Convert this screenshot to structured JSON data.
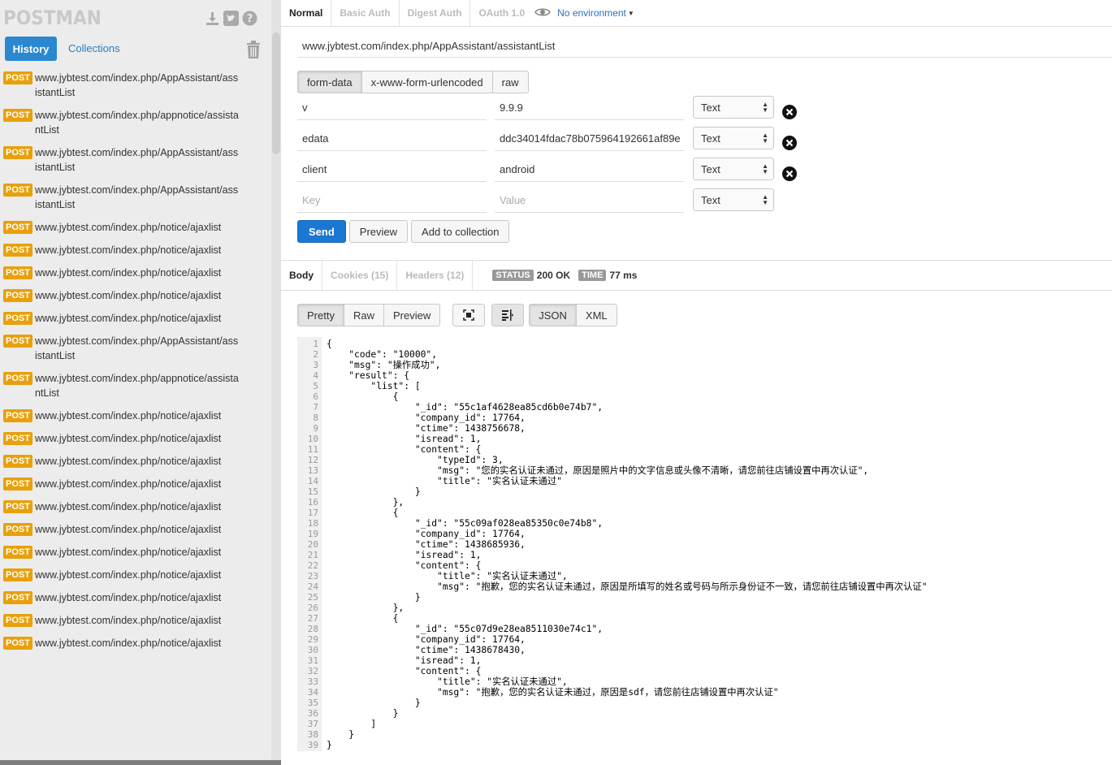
{
  "sidebar": {
    "logo": "POSTMAN",
    "tabs": {
      "history": "History",
      "collections": "Collections"
    },
    "history": [
      {
        "method": "POST",
        "url": "www.jybtest.com/index.php/AppAssistant/assistantList"
      },
      {
        "method": "POST",
        "url": "www.jybtest.com/index.php/appnotice/assistantList"
      },
      {
        "method": "POST",
        "url": "www.jybtest.com/index.php/AppAssistant/assistantList"
      },
      {
        "method": "POST",
        "url": "www.jybtest.com/index.php/AppAssistant/assistantList"
      },
      {
        "method": "POST",
        "url": "www.jybtest.com/index.php/notice/ajaxlist"
      },
      {
        "method": "POST",
        "url": "www.jybtest.com/index.php/notice/ajaxlist"
      },
      {
        "method": "POST",
        "url": "www.jybtest.com/index.php/notice/ajaxlist"
      },
      {
        "method": "POST",
        "url": "www.jybtest.com/index.php/notice/ajaxlist"
      },
      {
        "method": "POST",
        "url": "www.jybtest.com/index.php/notice/ajaxlist"
      },
      {
        "method": "POST",
        "url": "www.jybtest.com/index.php/AppAssistant/assistantList"
      },
      {
        "method": "POST",
        "url": "www.jybtest.com/index.php/appnotice/assistantList"
      },
      {
        "method": "POST",
        "url": "www.jybtest.com/index.php/notice/ajaxlist"
      },
      {
        "method": "POST",
        "url": "www.jybtest.com/index.php/notice/ajaxlist"
      },
      {
        "method": "POST",
        "url": "www.jybtest.com/index.php/notice/ajaxlist"
      },
      {
        "method": "POST",
        "url": "www.jybtest.com/index.php/notice/ajaxlist"
      },
      {
        "method": "POST",
        "url": "www.jybtest.com/index.php/notice/ajaxlist"
      },
      {
        "method": "POST",
        "url": "www.jybtest.com/index.php/notice/ajaxlist"
      },
      {
        "method": "POST",
        "url": "www.jybtest.com/index.php/notice/ajaxlist"
      },
      {
        "method": "POST",
        "url": "www.jybtest.com/index.php/notice/ajaxlist"
      },
      {
        "method": "POST",
        "url": "www.jybtest.com/index.php/notice/ajaxlist"
      },
      {
        "method": "POST",
        "url": "www.jybtest.com/index.php/notice/ajaxlist"
      },
      {
        "method": "POST",
        "url": "www.jybtest.com/index.php/notice/ajaxlist"
      }
    ]
  },
  "auth_tabs": [
    "Normal",
    "Basic Auth",
    "Digest Auth",
    "OAuth 1.0"
  ],
  "environment": "No environment",
  "request_url": "www.jybtest.com/index.php/AppAssistant/assistantList",
  "body_modes": [
    "form-data",
    "x-www-form-urlencoded",
    "raw"
  ],
  "params": [
    {
      "key": "v",
      "value": "9.9.9",
      "type": "Text"
    },
    {
      "key": "edata",
      "value": "ddc34014fdac78b075964192661af89e",
      "type": "Text"
    },
    {
      "key": "client",
      "value": "android",
      "type": "Text"
    }
  ],
  "new_param": {
    "key_placeholder": "Key",
    "value_placeholder": "Value",
    "type": "Text"
  },
  "actions": {
    "send": "Send",
    "preview": "Preview",
    "add_to_collection": "Add to collection"
  },
  "response_tabs": [
    "Body",
    "Cookies (15)",
    "Headers (12)"
  ],
  "status": {
    "status_label": "STATUS",
    "status_value": "200 OK",
    "time_label": "TIME",
    "time_value": "77 ms"
  },
  "view_modes": [
    "Pretty",
    "Raw",
    "Preview"
  ],
  "format_modes": [
    "JSON",
    "XML"
  ],
  "response_lines": [
    "{",
    "    \"code\": \"10000\",",
    "    \"msg\": \"操作成功\",",
    "    \"result\": {",
    "        \"list\": [",
    "            {",
    "                \"_id\": \"55c1af4628ea85cd6b0e74b7\",",
    "                \"company_id\": 17764,",
    "                \"ctime\": 1438756678,",
    "                \"isread\": 1,",
    "                \"content\": {",
    "                    \"typeId\": 3,",
    "                    \"msg\": \"您的实名认证未通过，原因是照片中的文字信息或头像不清晰，请您前往店铺设置中再次认证\",",
    "                    \"title\": \"实名认证未通过\"",
    "                }",
    "            },",
    "            {",
    "                \"_id\": \"55c09af028ea85350c0e74b8\",",
    "                \"company_id\": 17764,",
    "                \"ctime\": 1438685936,",
    "                \"isread\": 1,",
    "                \"content\": {",
    "                    \"title\": \"实名认证未通过\",",
    "                    \"msg\": \"抱歉，您的实名认证未通过，原因是所填写的姓名或号码与所示身份证不一致，请您前往店铺设置中再次认证\"",
    "                }",
    "            },",
    "            {",
    "                \"_id\": \"55c07d9e28ea8511030e74c1\",",
    "                \"company_id\": 17764,",
    "                \"ctime\": 1438678430,",
    "                \"isread\": 1,",
    "                \"content\": {",
    "                    \"title\": \"实名认证未通过\",",
    "                    \"msg\": \"抱歉，您的实名认证未通过，原因是sdf，请您前往店铺设置中再次认证\"",
    "                }",
    "            }",
    "        ]",
    "    }",
    "}"
  ],
  "colors": {
    "accent": "#2a88d1",
    "post_badge": "#e8a00b",
    "send": "#1a78d2"
  }
}
